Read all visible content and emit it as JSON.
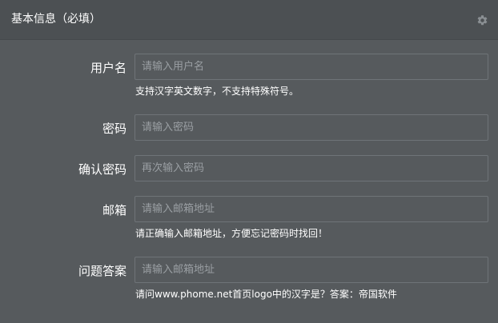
{
  "panel": {
    "title": "基本信息（必填）",
    "settings_icon": "gear-icon"
  },
  "form": {
    "username": {
      "label": "用户名",
      "placeholder": "请输入用户名",
      "hint": "支持汉字英文数字，不支持特殊符号。"
    },
    "password": {
      "label": "密码",
      "placeholder": "请输入密码"
    },
    "confirm_password": {
      "label": "确认密码",
      "placeholder": "再次输入密码"
    },
    "email": {
      "label": "邮箱",
      "placeholder": "请输入邮箱地址",
      "hint": "请正确输入邮箱地址，方便忘记密码时找回！"
    },
    "security_answer": {
      "label": "问题答案",
      "placeholder": "请输入邮箱地址",
      "hint": "请问www.phome.net首页logo中的汉字是？答案：帝国软件"
    }
  }
}
